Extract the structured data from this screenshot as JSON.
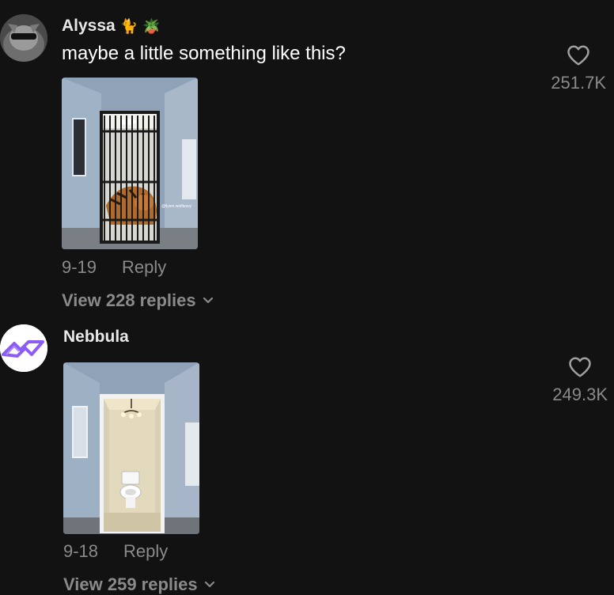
{
  "comments": [
    {
      "username": "Alyssa",
      "emojis": [
        "🐈",
        "🪴"
      ],
      "text": "maybe a little something like this?",
      "date": "9-19",
      "reply_label": "Reply",
      "view_replies": "View 228 replies",
      "likes": "251.7K",
      "media_watermark": "@ilysm.wolfiesvy"
    },
    {
      "username": "Nebbula",
      "date": "9-18",
      "reply_label": "Reply",
      "view_replies": "View 259 replies",
      "likes": "249.3K"
    }
  ],
  "colors": {
    "background": "#121212",
    "secondary_text": "#8a8a8a",
    "logo_purple": "#8b5cf6"
  }
}
